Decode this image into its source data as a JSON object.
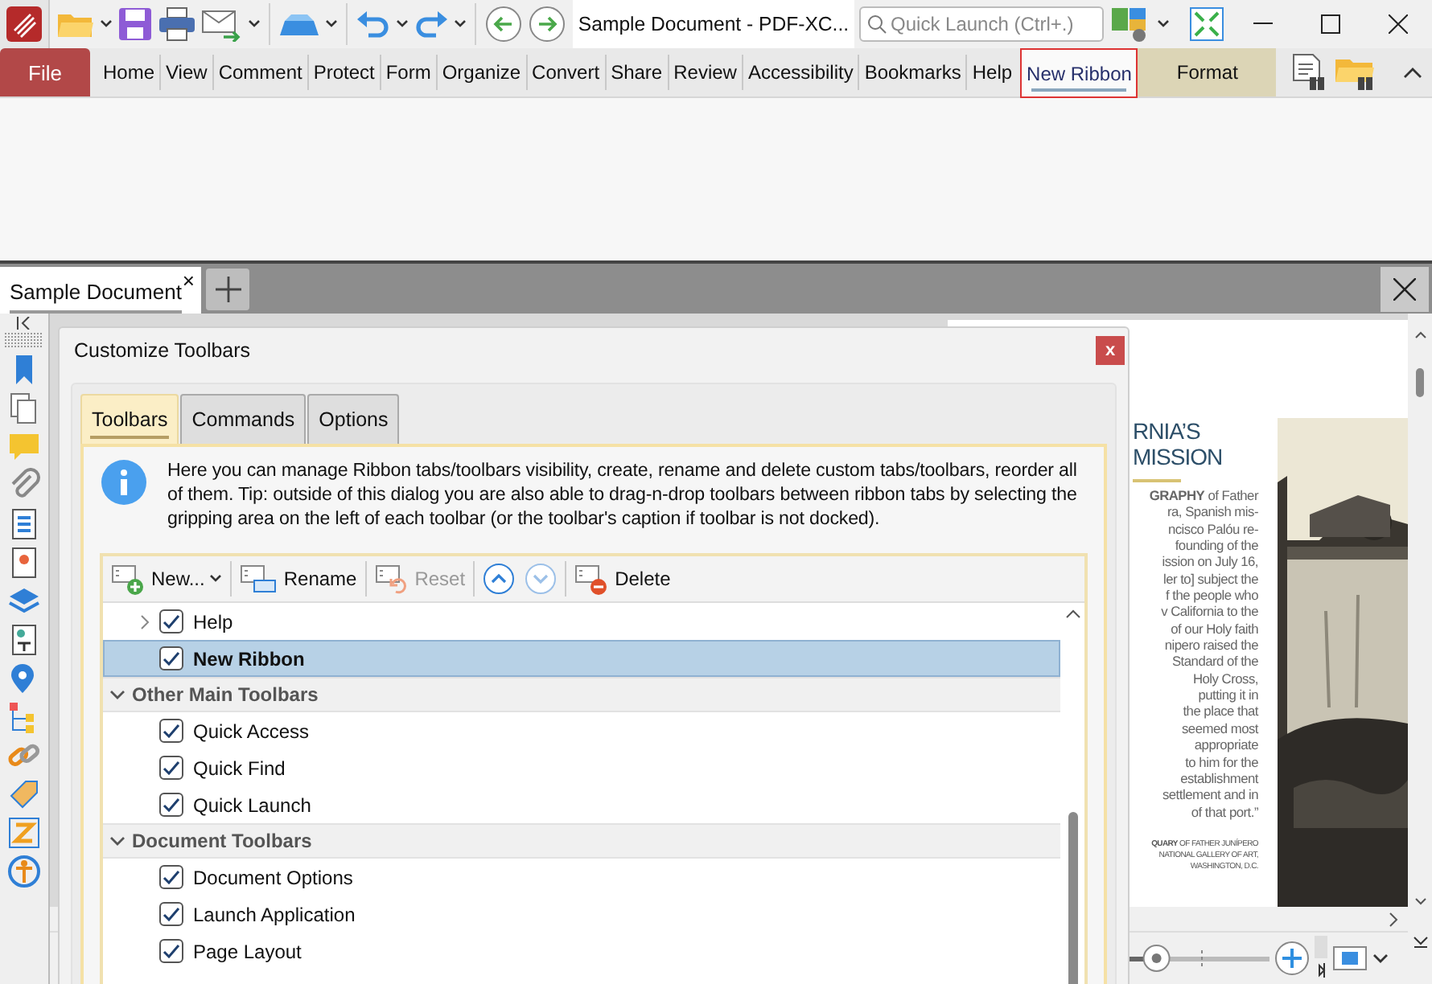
{
  "titlebar": {
    "title": "Sample Document - PDF-XC...",
    "quick_launch": {
      "placeholder": "Quick Launch (Ctrl+.)"
    }
  },
  "ribbon": {
    "file": "File",
    "tabs": [
      {
        "label": "Home",
        "selected": false,
        "kind": "normal"
      },
      {
        "label": "View",
        "selected": false,
        "kind": "normal"
      },
      {
        "label": "Comment",
        "selected": false,
        "kind": "normal"
      },
      {
        "label": "Protect",
        "selected": false,
        "kind": "normal"
      },
      {
        "label": "Form",
        "selected": false,
        "kind": "normal"
      },
      {
        "label": "Organize",
        "selected": false,
        "kind": "normal"
      },
      {
        "label": "Convert",
        "selected": false,
        "kind": "normal"
      },
      {
        "label": "Share",
        "selected": false,
        "kind": "normal"
      },
      {
        "label": "Review",
        "selected": false,
        "kind": "normal"
      },
      {
        "label": "Accessibility",
        "selected": false,
        "kind": "normal"
      },
      {
        "label": "Bookmarks",
        "selected": false,
        "kind": "normal"
      },
      {
        "label": "Help",
        "selected": false,
        "kind": "normal"
      },
      {
        "label": "New Ribbon",
        "selected": true,
        "kind": "normal"
      },
      {
        "label": "Format",
        "selected": false,
        "kind": "contextual"
      }
    ]
  },
  "document_tabs": [
    {
      "label": "Sample Document",
      "selected": true,
      "close": "×"
    }
  ],
  "dialog": {
    "title": "Customize Toolbars",
    "close": "x",
    "tabs": [
      {
        "label": "Toolbars",
        "selected": true
      },
      {
        "label": "Commands",
        "selected": false
      },
      {
        "label": "Options",
        "selected": false
      }
    ],
    "info": "Here you can manage Ribbon tabs/toolbars visibility, create, rename and delete custom tabs/toolbars, reorder all of them. Tip: outside of this dialog you are also able to drag-n-drop toolbars between ribbon tabs by selecting the gripping area on the left of each toolbar (or the toolbar's caption if toolbar is not docked).",
    "toolbar": [
      {
        "kind": "new",
        "label": "New...",
        "disabled": false,
        "dropdown": true
      },
      {
        "kind": "rename",
        "label": "Rename",
        "disabled": false,
        "dropdown": false
      },
      {
        "kind": "reset",
        "label": "Reset",
        "disabled": true,
        "dropdown": false
      },
      {
        "kind": "up",
        "disabled": false,
        "dropdown": false
      },
      {
        "kind": "down",
        "disabled": true,
        "dropdown": false
      },
      {
        "kind": "delete",
        "label": "Delete",
        "disabled": false,
        "dropdown": false
      }
    ],
    "tree": [
      {
        "kind": "node",
        "label": "Help",
        "checked": true,
        "selected": false,
        "expanded": false
      },
      {
        "kind": "leaf",
        "label": "New Ribbon",
        "checked": true,
        "selected": true
      },
      {
        "kind": "group",
        "label": "Other Main Toolbars",
        "expanded": true,
        "children": [
          {
            "kind": "leaf",
            "label": "Quick Access",
            "checked": true,
            "selected": false
          },
          {
            "kind": "leaf",
            "label": "Quick Find",
            "checked": true,
            "selected": false
          },
          {
            "kind": "leaf",
            "label": "Quick Launch",
            "checked": true,
            "selected": false
          }
        ]
      },
      {
        "kind": "group",
        "label": "Document Toolbars",
        "expanded": true,
        "children": [
          {
            "kind": "leaf",
            "label": "Document Options",
            "checked": true,
            "selected": false
          },
          {
            "kind": "leaf",
            "label": "Launch Application",
            "checked": true,
            "selected": false
          },
          {
            "kind": "leaf",
            "label": "Page Layout",
            "checked": true,
            "selected": false
          }
        ]
      }
    ]
  },
  "status": {
    "zoom_slider": {
      "level": 0.15
    }
  },
  "page": {
    "heading": [
      "RNIA’S",
      "MISSION"
    ],
    "lines": [
      "**GRAPHY** of Father",
      "ra, Spanish mis-",
      "ncisco Palóu re-",
      "founding of the",
      "ission on July 16,",
      "ler to] subject the",
      "f the people who",
      "v California to the",
      "of our Holy faith",
      "nipero raised the",
      "Standard of the",
      "Holy Cross,",
      "putting it in",
      "the place that",
      "seemed most",
      "appropriate",
      "to him for the",
      "establishment",
      "settlement and in",
      "of that port.”"
    ],
    "caption": [
      "**QUARY** OF FATHER JUNÍPERO",
      "NATIONAL GALLERY OF ART,",
      "WASHINGTON, D.C."
    ]
  }
}
